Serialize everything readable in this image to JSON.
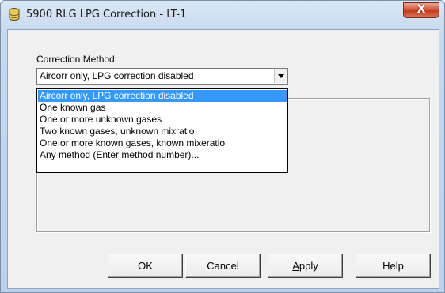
{
  "window": {
    "title": "5900 RLG LPG Correction - LT-1",
    "close_label": "X"
  },
  "form": {
    "correction_method_label": "Correction Method:",
    "selected_value": "Aircorr only, LPG correction disabled",
    "options": [
      "Aircorr only, LPG correction disabled",
      "One known gas",
      "One or more unknown gases",
      "Two known gases, unknown mixratio",
      "One or more known gases, known mixeratio",
      "Any method (Enter method number)..."
    ],
    "selected_index": 0
  },
  "buttons": {
    "ok": "OK",
    "cancel": "Cancel",
    "apply_underlined": "A",
    "apply_rest": "pply",
    "help": "Help"
  },
  "icons": {
    "app": "database-cylinder-icon",
    "close": "close-icon",
    "dropdown": "chevron-down-icon"
  },
  "colors": {
    "selection": "#3399ff",
    "close_button": "#c53c1c"
  }
}
